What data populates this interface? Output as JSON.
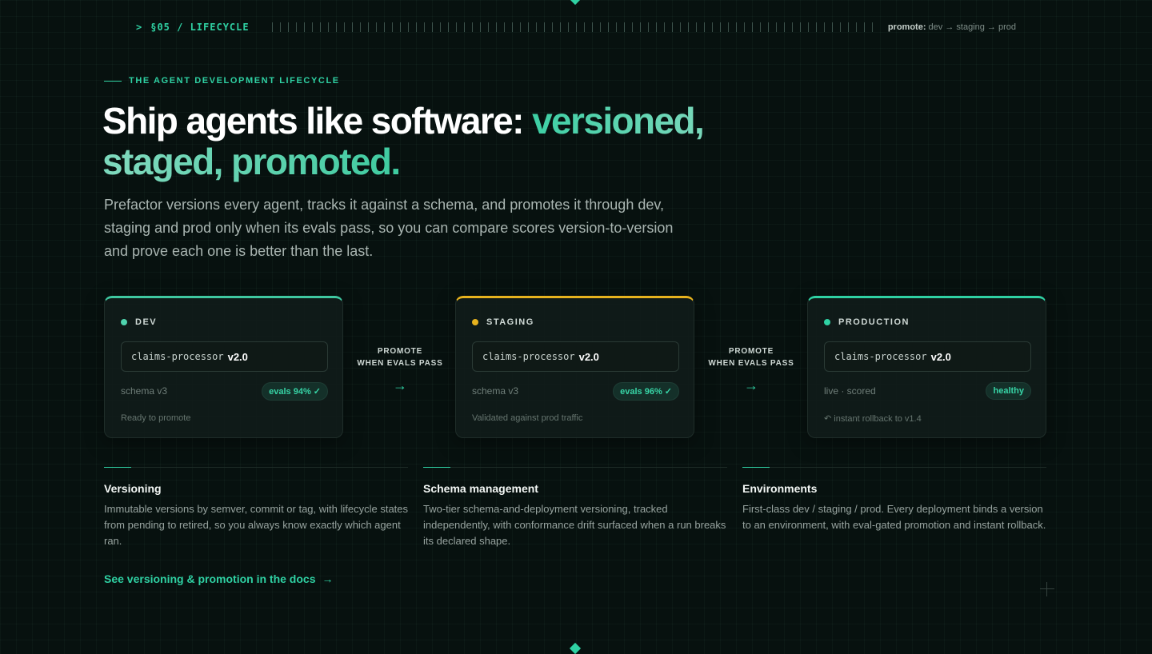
{
  "section": {
    "chevron": ">",
    "label": "§05 / LIFECYCLE",
    "promote_label": "promote:",
    "promote_path": "dev → staging → prod"
  },
  "eyebrow": "THE AGENT DEVELOPMENT LIFECYCLE",
  "headline": {
    "plain": "Ship agents like software: ",
    "accent": "versioned, staged, promoted."
  },
  "lead": "Prefactor versions every agent, tracks it against a schema, and promotes it through dev, staging and prod only when its evals pass, so you can compare scores version-to-version and prove each one is better than the last.",
  "environments": [
    {
      "name": "DEV",
      "agent": "claims-processor",
      "version": "v2.0",
      "meta": "schema v3",
      "badge": "evals 94% ✓",
      "footnote": "Ready to promote"
    },
    {
      "name": "STAGING",
      "agent": "claims-processor",
      "version": "v2.0",
      "meta": "schema v3",
      "badge": "evals 96% ✓",
      "footnote": "Validated against prod traffic"
    },
    {
      "name": "PRODUCTION",
      "agent": "claims-processor",
      "version": "v2.0",
      "meta": "live · scored",
      "badge": "healthy",
      "footnote": "↶ instant rollback to v1.4"
    }
  ],
  "connectors": [
    {
      "line1": "PROMOTE",
      "line2": "WHEN EVALS PASS",
      "arrow": "→"
    },
    {
      "line1": "PROMOTE",
      "line2": "WHEN EVALS PASS",
      "arrow": "→"
    }
  ],
  "features": [
    {
      "title": "Versioning",
      "body": "Immutable versions by semver, commit or tag, with lifecycle states from pending to retired, so you always know exactly which agent ran."
    },
    {
      "title": "Schema management",
      "body": "Two-tier schema-and-deployment versioning, tracked independently, with conformance drift surfaced when a run breaks its declared shape."
    },
    {
      "title": "Environments",
      "body": "First-class dev / staging / prod. Every deployment binds a version to an environment, with eval-gated promotion and instant rollback."
    }
  ],
  "docs_link": {
    "label": "See versioning & promotion in the docs",
    "arrow": "→"
  },
  "colors": {
    "background": "#07110f",
    "accent": "#2fd1a3",
    "staging": "#e6b21e",
    "dev": "#4fd3ad"
  }
}
